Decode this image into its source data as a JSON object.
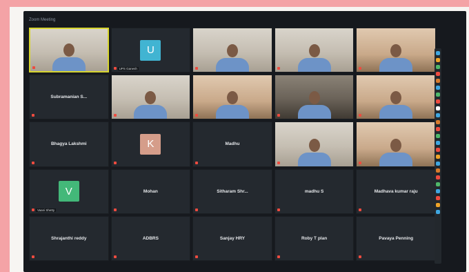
{
  "window": {
    "title": "Zoom Meeting"
  },
  "colors": {
    "active_speaker": "#d7d52e",
    "mute": "#ee4b3f",
    "avatar_blue": "#41b4d2",
    "avatar_peach": "#d59d8a",
    "avatar_green": "#43b879"
  },
  "tiles": [
    {
      "kind": "video",
      "name": "",
      "active": true
    },
    {
      "kind": "avatar",
      "initial": "U",
      "avatar_color": "#41b4d2",
      "chip": "UPS Ganesh"
    },
    {
      "kind": "video",
      "name": ""
    },
    {
      "kind": "video",
      "name": ""
    },
    {
      "kind": "video",
      "name": ""
    },
    {
      "kind": "name",
      "name": "Subramanian S..."
    },
    {
      "kind": "video",
      "name": ""
    },
    {
      "kind": "video",
      "name": ""
    },
    {
      "kind": "video",
      "name": ""
    },
    {
      "kind": "video",
      "name": ""
    },
    {
      "kind": "name",
      "name": "Bhagya Lakshmi"
    },
    {
      "kind": "avatar",
      "initial": "K",
      "avatar_color": "#d59d8a"
    },
    {
      "kind": "name",
      "name": "Madhu"
    },
    {
      "kind": "video",
      "name": ""
    },
    {
      "kind": "video",
      "name": ""
    },
    {
      "kind": "avatar",
      "initial": "V",
      "avatar_color": "#43b879",
      "chip": "Vaani Shetty"
    },
    {
      "kind": "name",
      "name": "Mohan"
    },
    {
      "kind": "name",
      "name": "Sitharam Shr..."
    },
    {
      "kind": "name",
      "name": "madhu S"
    },
    {
      "kind": "name",
      "name": "Madhava kumar raju"
    },
    {
      "kind": "name",
      "name": "Shrajanthi reddy"
    },
    {
      "kind": "name",
      "name": "ADBRS"
    },
    {
      "kind": "name",
      "name": "Sanjay HRY"
    },
    {
      "kind": "name",
      "name": "Roby T plan"
    },
    {
      "kind": "name",
      "name": "Pavaya Penning"
    }
  ],
  "side_panel": {
    "dots": [
      "#3fa7e1",
      "#f0a428",
      "#4fb86a",
      "#ee4b3f",
      "#d97b2c",
      "#3fa7e1",
      "#4fb86a",
      "#ee4b3f",
      "#ffffff",
      "#3fa7e1",
      "#d97b2c",
      "#ee4b3f",
      "#4fb86a",
      "#3fa7e1",
      "#ee4b3f",
      "#f0a428",
      "#3fa7e1",
      "#d97b2c",
      "#ee4b3f",
      "#4fb86a",
      "#3fa7e1",
      "#ee4b3f",
      "#f0a428",
      "#3fa7e1"
    ]
  }
}
